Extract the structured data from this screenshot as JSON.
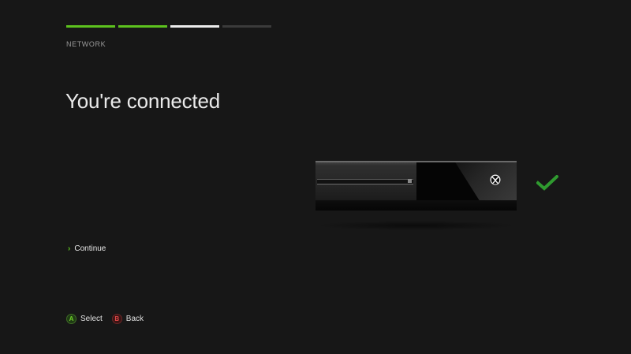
{
  "progress": {
    "steps": [
      "done",
      "done",
      "current",
      "pending"
    ]
  },
  "header": {
    "section_label": "NETWORK"
  },
  "main": {
    "title": "You're connected",
    "continue_label": "Continue",
    "status_icon": "check-icon"
  },
  "footer": {
    "select": {
      "button": "A",
      "label": "Select"
    },
    "back": {
      "button": "B",
      "label": "Back"
    }
  },
  "colors": {
    "accent": "#5dc21e",
    "background": "#171717",
    "current_step": "#ececec",
    "pending_step": "#3b3b3b",
    "button_a": "#6fd12a",
    "button_b": "#e04848",
    "check": "#2f9a2f"
  }
}
